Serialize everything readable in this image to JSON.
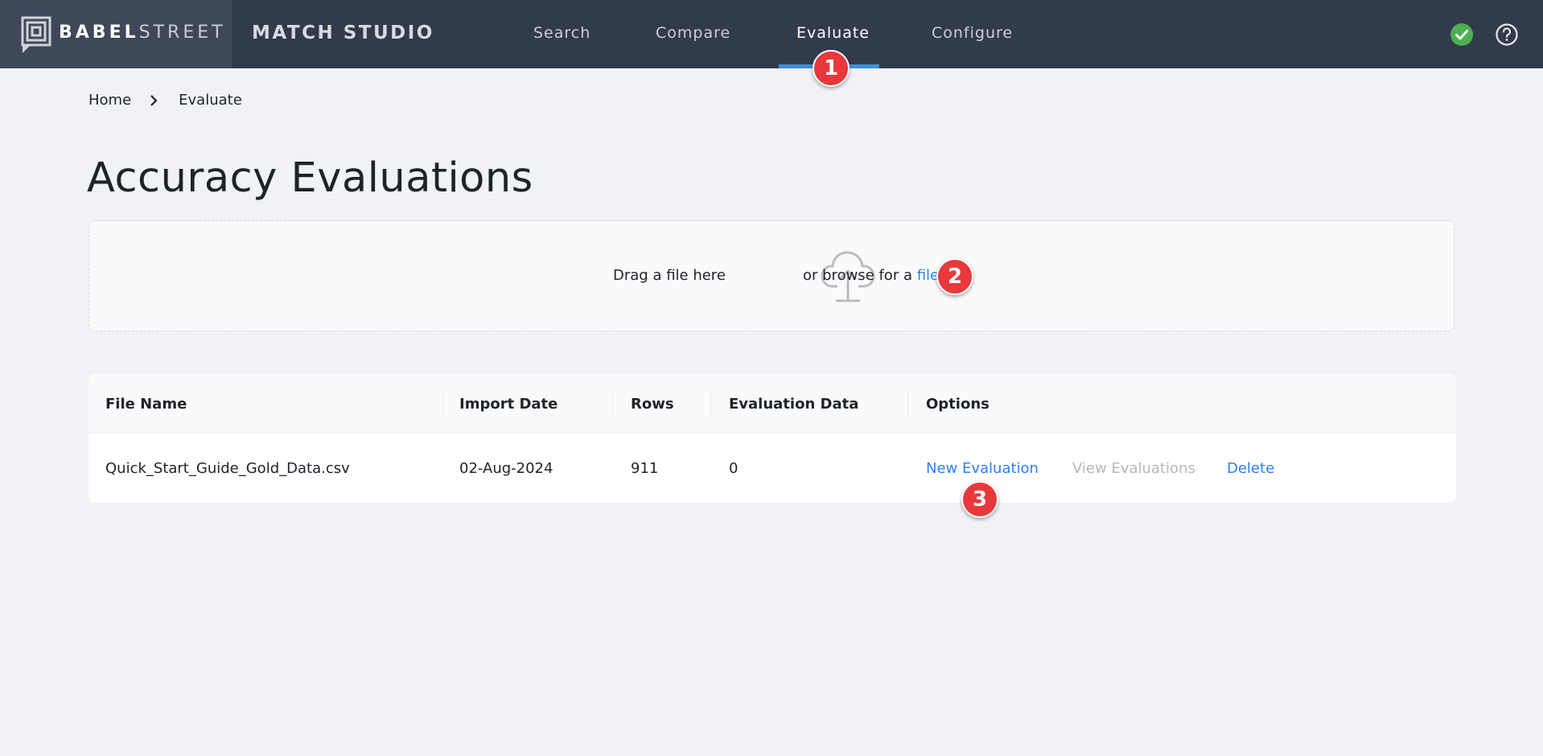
{
  "header": {
    "brand_bold": "BABEL",
    "brand_light": "STREET",
    "product": "MATCH STUDIO",
    "nav": [
      {
        "label": "Search"
      },
      {
        "label": "Compare"
      },
      {
        "label": "Evaluate",
        "active": true
      },
      {
        "label": "Configure"
      }
    ],
    "status_color": "#4caf50"
  },
  "breadcrumb": {
    "home": "Home",
    "current": "Evaluate"
  },
  "page_title": "Accuracy Evaluations",
  "dropzone": {
    "drag_text": "Drag a file here",
    "browse_text": "or browse for a",
    "browse_link": "file"
  },
  "table": {
    "columns": [
      "File Name",
      "Import Date",
      "Rows",
      "Evaluation Data",
      "Options"
    ],
    "rows": [
      {
        "file_name": "Quick_Start_Guide_Gold_Data.csv",
        "import_date": "02-Aug-2024",
        "rows": "911",
        "evaluation_data": "0",
        "options": {
          "new_evaluation": "New Evaluation",
          "view_evaluations": "View Evaluations",
          "delete": "Delete"
        }
      }
    ]
  },
  "step_markers": [
    "1",
    "2",
    "3"
  ],
  "colors": {
    "accent": "#2f80ed",
    "header": "#323b4b",
    "marker": "#e8383c"
  }
}
